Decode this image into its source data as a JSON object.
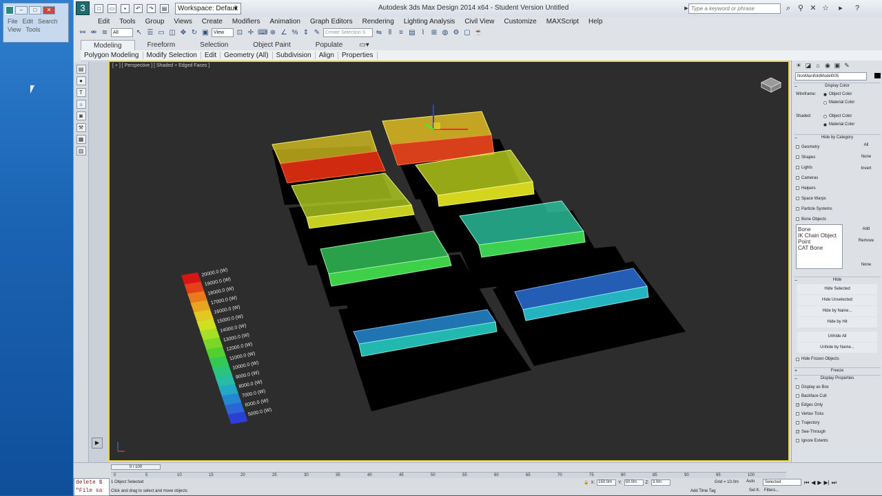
{
  "desktop": {
    "small_window": {
      "menu": [
        "File",
        "Edit",
        "Search"
      ],
      "menu2": [
        "View",
        "Tools"
      ]
    }
  },
  "app": {
    "title": "Autodesk 3ds Max Design 2014 x64 - Student Version    Untitled",
    "workspace": "Workspace: Default",
    "search_placeholder": "Type a keyword or phrase"
  },
  "menubar": [
    "Edit",
    "Tools",
    "Group",
    "Views",
    "Create",
    "Modifiers",
    "Animation",
    "Graph Editors",
    "Rendering",
    "Lighting Analysis",
    "Civil View",
    "Customize",
    "MAXScript",
    "Help"
  ],
  "toolbar": {
    "filter_value": "All",
    "view_value": "View",
    "selection_set_placeholder": "Create Selection S"
  },
  "ribbon": {
    "tabs": [
      "Modeling",
      "Freeform",
      "Selection",
      "Object Paint",
      "Populate"
    ],
    "panels": [
      "Polygon Modeling",
      "Modify Selection",
      "Edit",
      "Geometry (All)",
      "Subdivision",
      "Align",
      "Properties"
    ]
  },
  "viewport": {
    "label": "[ + ] [ Perspective ] [ Shaded + Edged Faces ]",
    "legend": [
      "20000.0 (W)",
      "19000.0 (W)",
      "18000.0 (W)",
      "17000.0 (W)",
      "16000.0 (W)",
      "15000.0 (W)",
      "14000.0 (W)",
      "13000.0 (W)",
      "12000.0 (W)",
      "11000.0 (W)",
      "10000.0 (W)",
      "9000.0 (W)",
      "8000.0 (W)",
      "7000.0 (W)",
      "6000.0 (W)",
      "5000.0 (W)"
    ],
    "legend_colors": [
      "#d81414",
      "#e4401a",
      "#ea7a1c",
      "#e8a51e",
      "#e2c821",
      "#cde022",
      "#a6e024",
      "#7ad726",
      "#52d030",
      "#32ca52",
      "#2ac47c",
      "#27bca6",
      "#25a8c4",
      "#2488d0",
      "#2a66d6",
      "#2d3fd6"
    ]
  },
  "cmdpanel": {
    "object_name": "NonManifoldModel005",
    "display_color": {
      "title": "Display Color",
      "wireframe_label": "Wireframe:",
      "shaded_label": "Shaded:",
      "object_color": "Object Color",
      "material_color": "Material Color"
    },
    "hide_by_category": {
      "title": "Hide by Category",
      "items": [
        "Geometry",
        "Shapes",
        "Lights",
        "Cameras",
        "Helpers",
        "Space Warps",
        "Particle Systems",
        "Bone Objects"
      ],
      "buttons": [
        "All",
        "None",
        "Invert"
      ],
      "list": [
        "Bone",
        "IK Chain Object",
        "Point",
        "CAT Bone"
      ],
      "add": "Add",
      "remove": "Remove",
      "none": "None"
    },
    "hide": {
      "title": "Hide",
      "buttons": [
        "Hide Selected",
        "Hide Unselected",
        "Hide by Name...",
        "Hide by Hit",
        "Unhide All",
        "Unhide by Name..."
      ],
      "hide_frozen": "Hide Frozen Objects"
    },
    "freeze_title": "Freeze",
    "display_props": {
      "title": "Display Properties",
      "items": [
        "Display as Box",
        "Backface Cull",
        "Edges Only",
        "Vertex Ticks",
        "Trajectory",
        "See-Through",
        "Ignore Extents"
      ]
    }
  },
  "bottom": {
    "time_slider": "0 / 100",
    "ticks": [
      "0",
      "5",
      "10",
      "15",
      "20",
      "25",
      "30",
      "35",
      "40",
      "45",
      "50",
      "55",
      "60",
      "65",
      "70",
      "75",
      "80",
      "85",
      "90",
      "95",
      "100"
    ],
    "maxscript_lines": [
      "delete $",
      "\"File sa"
    ],
    "status1": "1 Object Selected",
    "status2": "Click and drag to select and move objects",
    "x_value": "150.0m",
    "y_value": "50.0m",
    "z_value": "3.0m",
    "grid": "Grid = 10.0m",
    "add_time_tag": "Add Time Tag",
    "auto": "Auto",
    "set_k": "Set K.",
    "filters": "Filters...",
    "selected": "Selected"
  }
}
